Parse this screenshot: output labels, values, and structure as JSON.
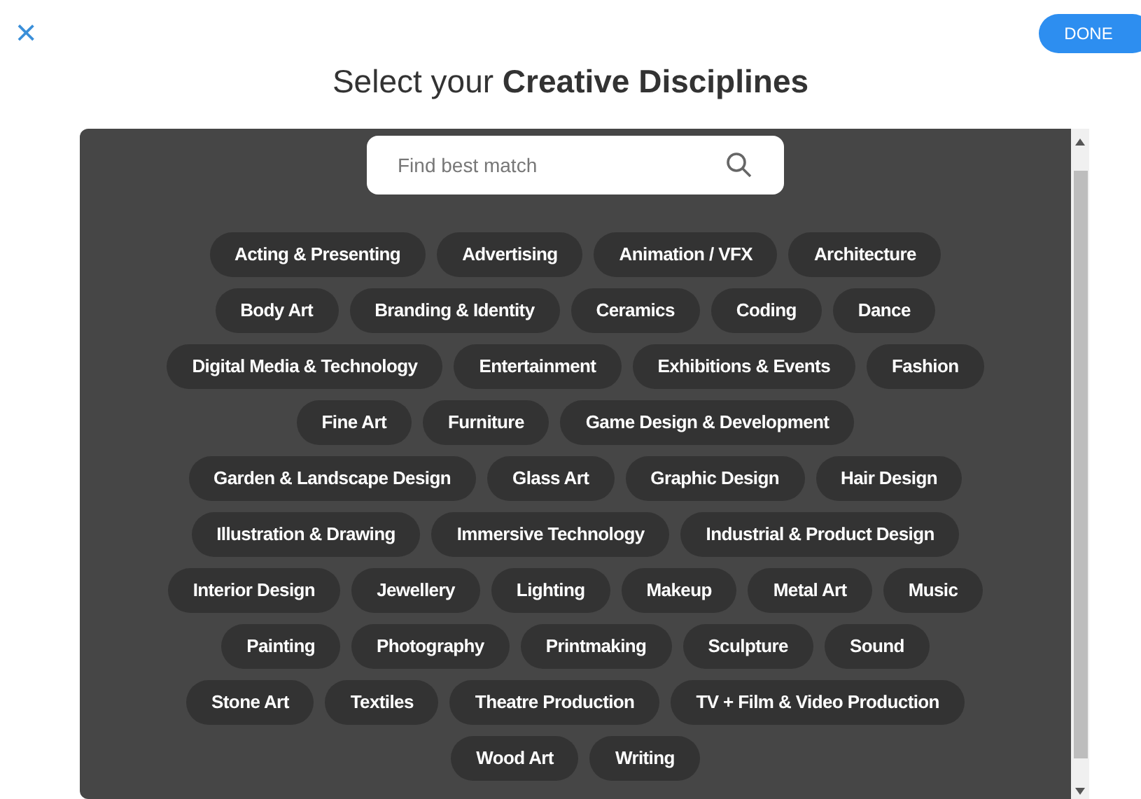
{
  "close_label": "×",
  "done_button": "DONE",
  "title": "Select your **Creative Disciplines**",
  "search": {
    "placeholder": "Find best match"
  },
  "rows": [
    [
      {
        "label": "Acting & Presenting",
        "selected": false
      },
      {
        "label": "Advertising",
        "selected": false
      },
      {
        "label": "Animation / VFX",
        "selected": false
      },
      {
        "label": "Architecture",
        "selected": false
      }
    ],
    [
      {
        "label": "Body Art",
        "selected": false
      },
      {
        "label": "Branding & Identity",
        "selected": false
      },
      {
        "label": "Ceramics",
        "selected": false
      },
      {
        "label": "Coding",
        "selected": false
      },
      {
        "label": "Dance",
        "selected": false
      }
    ],
    [
      {
        "label": "Digital Media & Technology",
        "selected": false
      },
      {
        "label": "Entertainment",
        "selected": false
      },
      {
        "label": "Exhibitions & Events",
        "selected": false
      },
      {
        "label": "Fashion",
        "selected": false
      }
    ],
    [
      {
        "label": "Fine Art",
        "selected": false
      },
      {
        "label": "Furniture",
        "selected": false
      },
      {
        "label": "Game Design & Development",
        "selected": false
      }
    ],
    [
      {
        "label": "Garden & Landscape Design",
        "selected": false
      },
      {
        "label": "Glass Art",
        "selected": false
      },
      {
        "label": "Graphic Design",
        "selected": false
      },
      {
        "label": "Hair Design",
        "selected": false
      }
    ],
    [
      {
        "label": "Illustration & Drawing",
        "selected": false
      },
      {
        "label": "Immersive Technology",
        "selected": false
      },
      {
        "label": "Industrial & Product Design",
        "selected": false
      }
    ],
    [
      {
        "label": "Interior Design",
        "selected": false
      },
      {
        "label": "Jewellery",
        "selected": false
      },
      {
        "label": "Lighting",
        "selected": false
      },
      {
        "label": "Makeup",
        "selected": false
      },
      {
        "label": "Metal Art",
        "selected": false
      },
      {
        "label": "Music",
        "selected": false
      }
    ],
    [
      {
        "label": "Painting",
        "selected": false
      },
      {
        "label": "Photography",
        "selected": false
      },
      {
        "label": "Printmaking",
        "selected": false
      },
      {
        "label": "Sculpture",
        "selected": false
      },
      {
        "label": "Sound",
        "selected": false
      }
    ],
    [
      {
        "label": "Stone Art",
        "selected": false
      },
      {
        "label": "Textiles",
        "selected": false
      },
      {
        "label": "Theatre Production",
        "selected": false
      },
      {
        "label": "TV + Film & Video Production",
        "selected": false
      }
    ],
    [
      {
        "label": "Wood Art",
        "selected": false
      },
      {
        "label": "Writing",
        "selected": false
      }
    ]
  ]
}
